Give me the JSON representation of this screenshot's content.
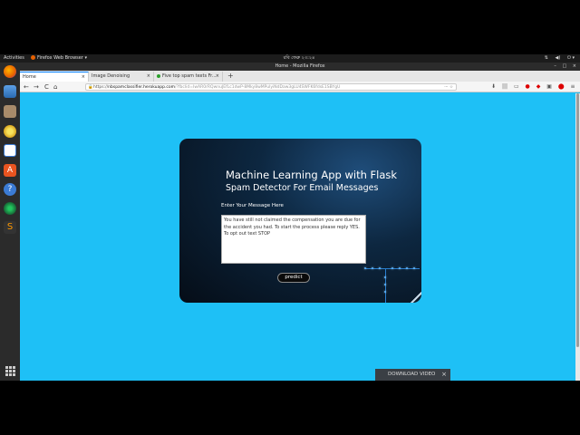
{
  "topbar": {
    "activities": "Activities",
    "app_menu": "Firefox Web Browser ▾",
    "clock": "রবি  ফেব্রু ২৩:২৪",
    "tray_icons": [
      "network-icon",
      "volume-icon",
      "power-icon"
    ]
  },
  "window": {
    "title": "Home - Mozilla Firefox",
    "controls": [
      "–",
      "□",
      "×"
    ]
  },
  "tabs": [
    {
      "label": "Home",
      "active": true
    },
    {
      "label": "Image Denoising",
      "active": false
    },
    {
      "label": "Five top spam texts Fr...",
      "active": false
    }
  ],
  "new_tab": "+",
  "nav": {
    "back": "←",
    "forward": "→",
    "reload": "C",
    "home": "⌂"
  },
  "url": {
    "lock": "🔒",
    "prefix": "https://",
    "host": "nbspamclassifier.herokuapp.com",
    "rest": "/?fbclid=IwAR0rRQwnuJEfLc1dwP-8Mky8wMPulyiNdDaw3gLU4SWFK6fdsE1SBYgU",
    "icons": "··· ☆"
  },
  "toolbar_icons": [
    "⬇",
    "|||",
    "▭",
    "●",
    "◆",
    "▣",
    "⬤",
    "≡"
  ],
  "page": {
    "title": "Machine Learning App with Flask",
    "subtitle": "Spam Detector For Email Messages",
    "message_label": "Enter Your Message Here",
    "message_value": "You have still not claimed the compensation you are due for the accident you had. To start the process please reply YES. To opt out text STOP",
    "predict_label": "predict"
  },
  "download_bar": {
    "label": "DOWNLOAD VIDEO",
    "close": "×"
  },
  "colors": {
    "page_background": "#1ec0f6",
    "card_dark": "#050d17",
    "accent_glow": "#5ab4ff"
  }
}
